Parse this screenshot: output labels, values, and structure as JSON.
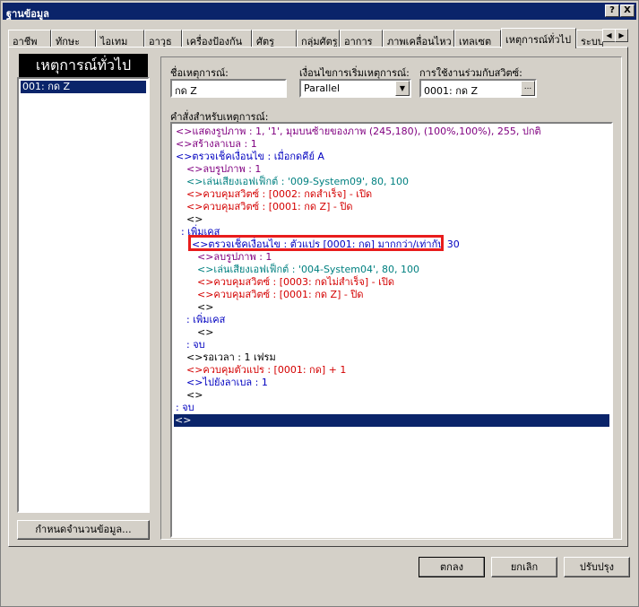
{
  "window": {
    "title": "ฐานข้อมูล",
    "help_btn": "?",
    "close_btn": "X"
  },
  "tabs": [
    {
      "label": "อาชีพ"
    },
    {
      "label": "ทักษะ"
    },
    {
      "label": "ไอเทม"
    },
    {
      "label": "อาวุธ"
    },
    {
      "label": "เครื่องป้องกัน"
    },
    {
      "label": "ศัตรู"
    },
    {
      "label": "กลุ่มศัตรู"
    },
    {
      "label": "อาการ"
    },
    {
      "label": "ภาพเคลื่อนไหว"
    },
    {
      "label": "เทลเซต"
    },
    {
      "label": "เหตุการณ์ทั่วไป"
    },
    {
      "label": "ระบบ"
    }
  ],
  "left_panel": {
    "title": "เหตุการณ์ทั่วไป",
    "items": [
      {
        "label": "001: กด Z"
      }
    ],
    "max_button": "กำหนดจำนวนข้อมูล..."
  },
  "form": {
    "name_label": "ชื่อเหตุการณ์:",
    "name_value": "กด Z",
    "condition_label": "เงื่อนไขการเริ่มเหตุการณ์:",
    "condition_value": "Parallel",
    "switch_label": "การใช้งานร่วมกับสวิตซ์:",
    "switch_value": "0001: กด Z",
    "switch_btn": "...",
    "commands_label": "คำสั่งสำหรับเหตุการณ์:"
  },
  "commands": [
    {
      "text": "<>แสดงรูปภาพ : 1, '1', มุมบนซ้ายของภาพ (245,180), (100%,100%), 255, ปกติ"
    },
    {
      "text": "<>สร้างลาเบล : 1"
    },
    {
      "text": "<>ตรวจเช็คเงื่อนไข : เมื่อกดคีย์ A"
    },
    {
      "text": "<>ลบรูปภาพ : 1"
    },
    {
      "text": "<>เล่นเสียงเอฟเฟ็กต์ : '009-System09', 80, 100"
    },
    {
      "text": "<>ควบคุมสวิตซ์ : [0002: กดสำเร็จ] - เปิด"
    },
    {
      "text": "<>ควบคุมสวิตซ์ : [0001: กด Z] - ปิด"
    },
    {
      "text": "<>"
    },
    {
      "text": ": เพิ่มเคส"
    },
    {
      "text": "<>ตรวจเช็คเงื่อนไข : ตัวแปร [0001: กด] มากกว่า/เท่ากับ 30"
    },
    {
      "text": "<>ลบรูปภาพ : 1"
    },
    {
      "text": "<>เล่นเสียงเอฟเฟ็กต์ : '004-System04', 80, 100"
    },
    {
      "text": "<>ควบคุมสวิตซ์ : [0003: กดไม่สำเร็จ] - เปิด"
    },
    {
      "text": "<>ควบคุมสวิตซ์ : [0001: กด Z] - ปิด"
    },
    {
      "text": "<>"
    },
    {
      "text": ": เพิ่มเคส"
    },
    {
      "text": "<>"
    },
    {
      "text": ": จบ"
    },
    {
      "text": "<>รอเวลา : 1 เฟรม"
    },
    {
      "text": "<>ควบคุมตัวแปร : [0001: กด] + 1"
    },
    {
      "text": "<>ไปยังลาเบล : 1"
    },
    {
      "text": "<>"
    },
    {
      "text": ": จบ"
    },
    {
      "text": "<>"
    }
  ],
  "footer": {
    "ok": "ตกลง",
    "cancel": "ยกเลิก",
    "apply": "ปรับปรุง"
  },
  "colors": {
    "selection": "#0a246a",
    "highlight_box": "#e81c1c"
  }
}
